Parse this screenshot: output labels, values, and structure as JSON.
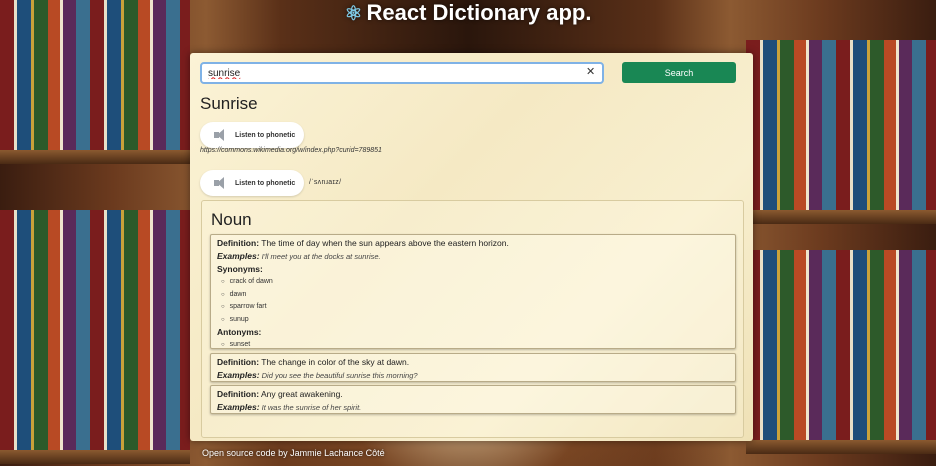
{
  "app": {
    "title": "React Dictionary app.",
    "logo_icon": "react-logo-icon"
  },
  "search": {
    "value": "sunrise",
    "placeholder": "",
    "clear_label": "✕",
    "button_label": "Search"
  },
  "result": {
    "word": "Sunrise",
    "phonetics": [
      {
        "button_label": "Listen to phonetic",
        "audio_url": "https://commons.wikimedia.org/w/index.php?curid=789851",
        "text": ""
      },
      {
        "button_label": "Listen to phonetic",
        "audio_url": "",
        "text": "/ˈsʌnɹaɪz/"
      }
    ],
    "meaning": {
      "part_of_speech": "Noun",
      "definitions": [
        {
          "definition_label": "Definition:",
          "definition": "The time of day when the sun appears above the eastern horizon.",
          "example_label": "Examples:",
          "example": "I'll meet you at the docks at sunrise.",
          "synonyms_label": "Synonyms:",
          "synonyms": [
            "crack of dawn",
            "dawn",
            "sparrow fart",
            "sunup"
          ],
          "antonyms_label": "Antonyms:",
          "antonyms": [
            "sunset"
          ]
        },
        {
          "definition_label": "Definition:",
          "definition": "The change in color of the sky at dawn.",
          "example_label": "Examples:",
          "example": "Did you see the beautiful sunrise this morning?"
        },
        {
          "definition_label": "Definition:",
          "definition": "Any great awakening.",
          "example_label": "Examples:",
          "example": "It was the sunrise of her spirit."
        }
      ]
    }
  },
  "footer": {
    "link_text": "Open source code",
    "separator": "by",
    "author": "Jammie Lachance Côté"
  },
  "colors": {
    "search_button": "#198754",
    "input_border": "#7fb2e6",
    "card_background": "#f8efcf"
  }
}
